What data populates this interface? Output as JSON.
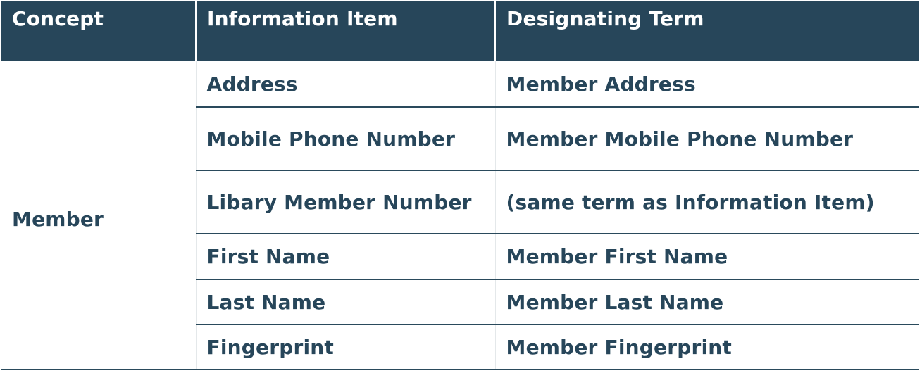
{
  "table": {
    "headers": [
      "Concept",
      "Information Item",
      "Designating Term"
    ],
    "concept": "Member",
    "rows": [
      {
        "information_item": "Address",
        "designating_term": "Member Address"
      },
      {
        "information_item": "Mobile Phone Number",
        "designating_term": "Member Mobile Phone Number"
      },
      {
        "information_item": "Libary Member Number",
        "designating_term": "(same term as Information Item)"
      },
      {
        "information_item": "First Name",
        "designating_term": "Member First Name"
      },
      {
        "information_item": "Last Name",
        "designating_term": "Member Last Name"
      },
      {
        "information_item": "Fingerprint",
        "designating_term": "Member Fingerprint"
      }
    ]
  },
  "colors": {
    "header_bg": "#27465a",
    "text": "#27465a",
    "rule": "#2a4a5c"
  }
}
